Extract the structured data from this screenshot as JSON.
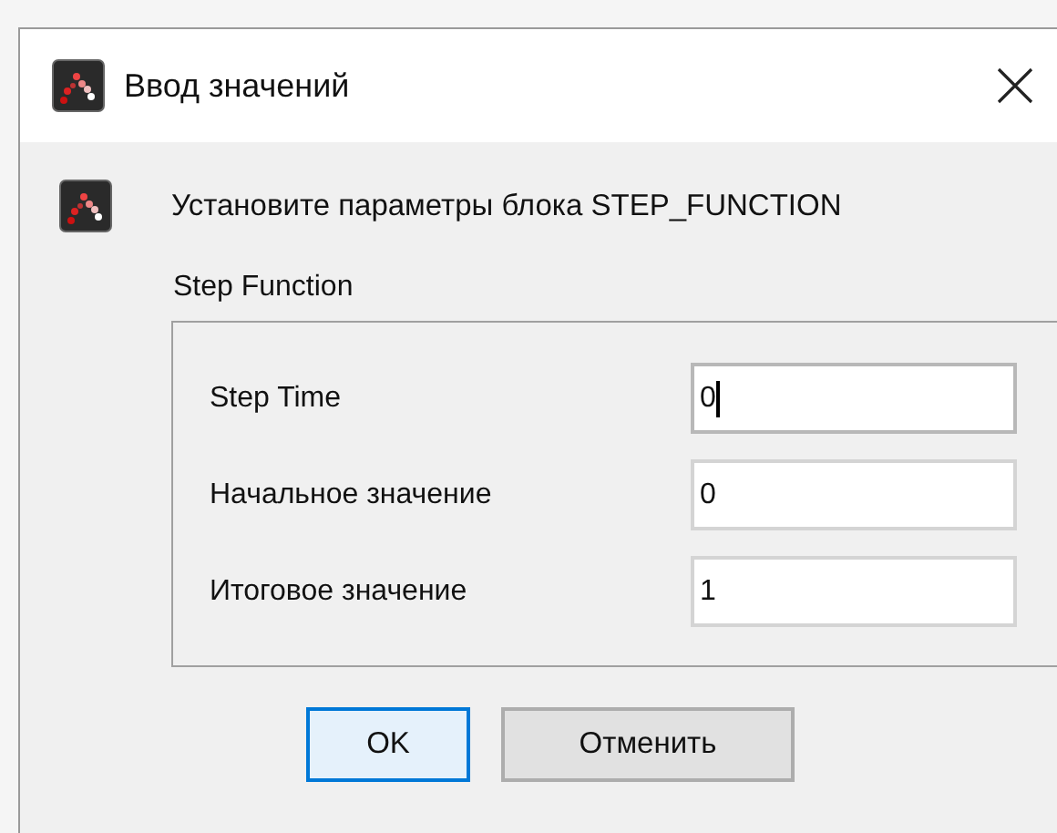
{
  "window": {
    "title": "Ввод значений"
  },
  "message": "Установите параметры блока STEP_FUNCTION",
  "group": {
    "title": "Step Function",
    "fields": [
      {
        "label": "Step Time",
        "value": "0",
        "focused": true
      },
      {
        "label": "Начальное значение",
        "value": "0",
        "focused": false
      },
      {
        "label": "Итоговое значение",
        "value": "1",
        "focused": false
      }
    ]
  },
  "buttons": [
    {
      "label": "OK",
      "default": true
    },
    {
      "label": "Отменить",
      "default": false
    }
  ]
}
